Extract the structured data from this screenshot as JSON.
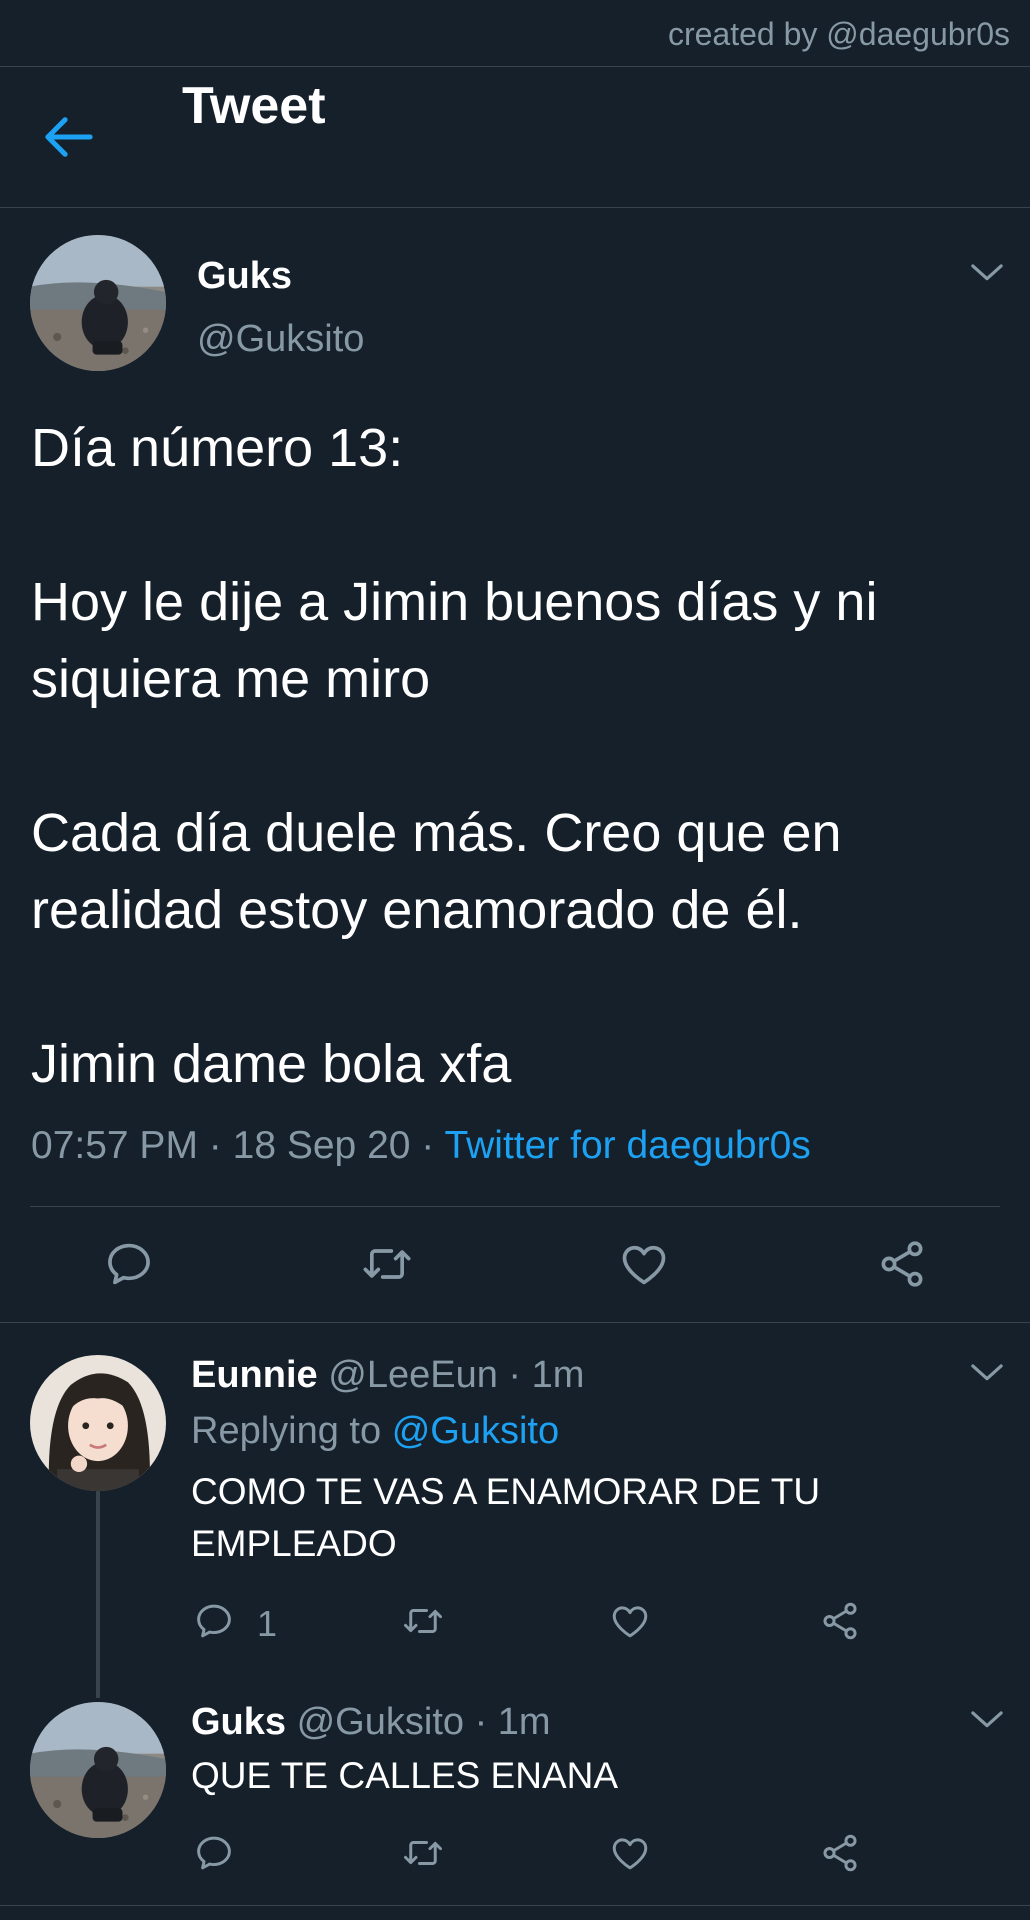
{
  "credit": "created by @daegubr0s",
  "header": {
    "title": "Tweet"
  },
  "tweet": {
    "author_name": "Guks",
    "author_handle": "@Guksito",
    "body": [
      "Día número 13:",
      "Hoy le dije a Jimin buenos días y ni siquiera me miro",
      "Cada día duele más. Creo que en realidad estoy enamorado de él.",
      "Jimin dame bola xfa"
    ],
    "time": "07:57 PM",
    "date": "18 Sep 20",
    "source": "Twitter for daegubr0s"
  },
  "replies": [
    {
      "author_name": "Eunnie",
      "author_handle": "@LeeEun",
      "time": "1m",
      "replying_label": "Replying to",
      "replying_to": "@Guksito",
      "text": "COMO TE VAS A ENAMORAR DE TU EMPLEADO",
      "reply_count": "1"
    },
    {
      "author_name": "Guks",
      "author_handle": "@Guksito",
      "time": "1m",
      "text": "QUE TE CALLES ENANA"
    }
  ],
  "icons": {
    "back": "arrow-left-icon",
    "more": "chevron-down-icon",
    "reply": "speech-bubble-icon",
    "retweet": "retweet-icon",
    "like": "heart-icon",
    "share": "share-icon"
  },
  "colors": {
    "background": "#15202b",
    "text": "#ffffff",
    "secondary_text": "#8899a6",
    "accent": "#1da1f2",
    "divider": "#38444d"
  },
  "separator": "·"
}
